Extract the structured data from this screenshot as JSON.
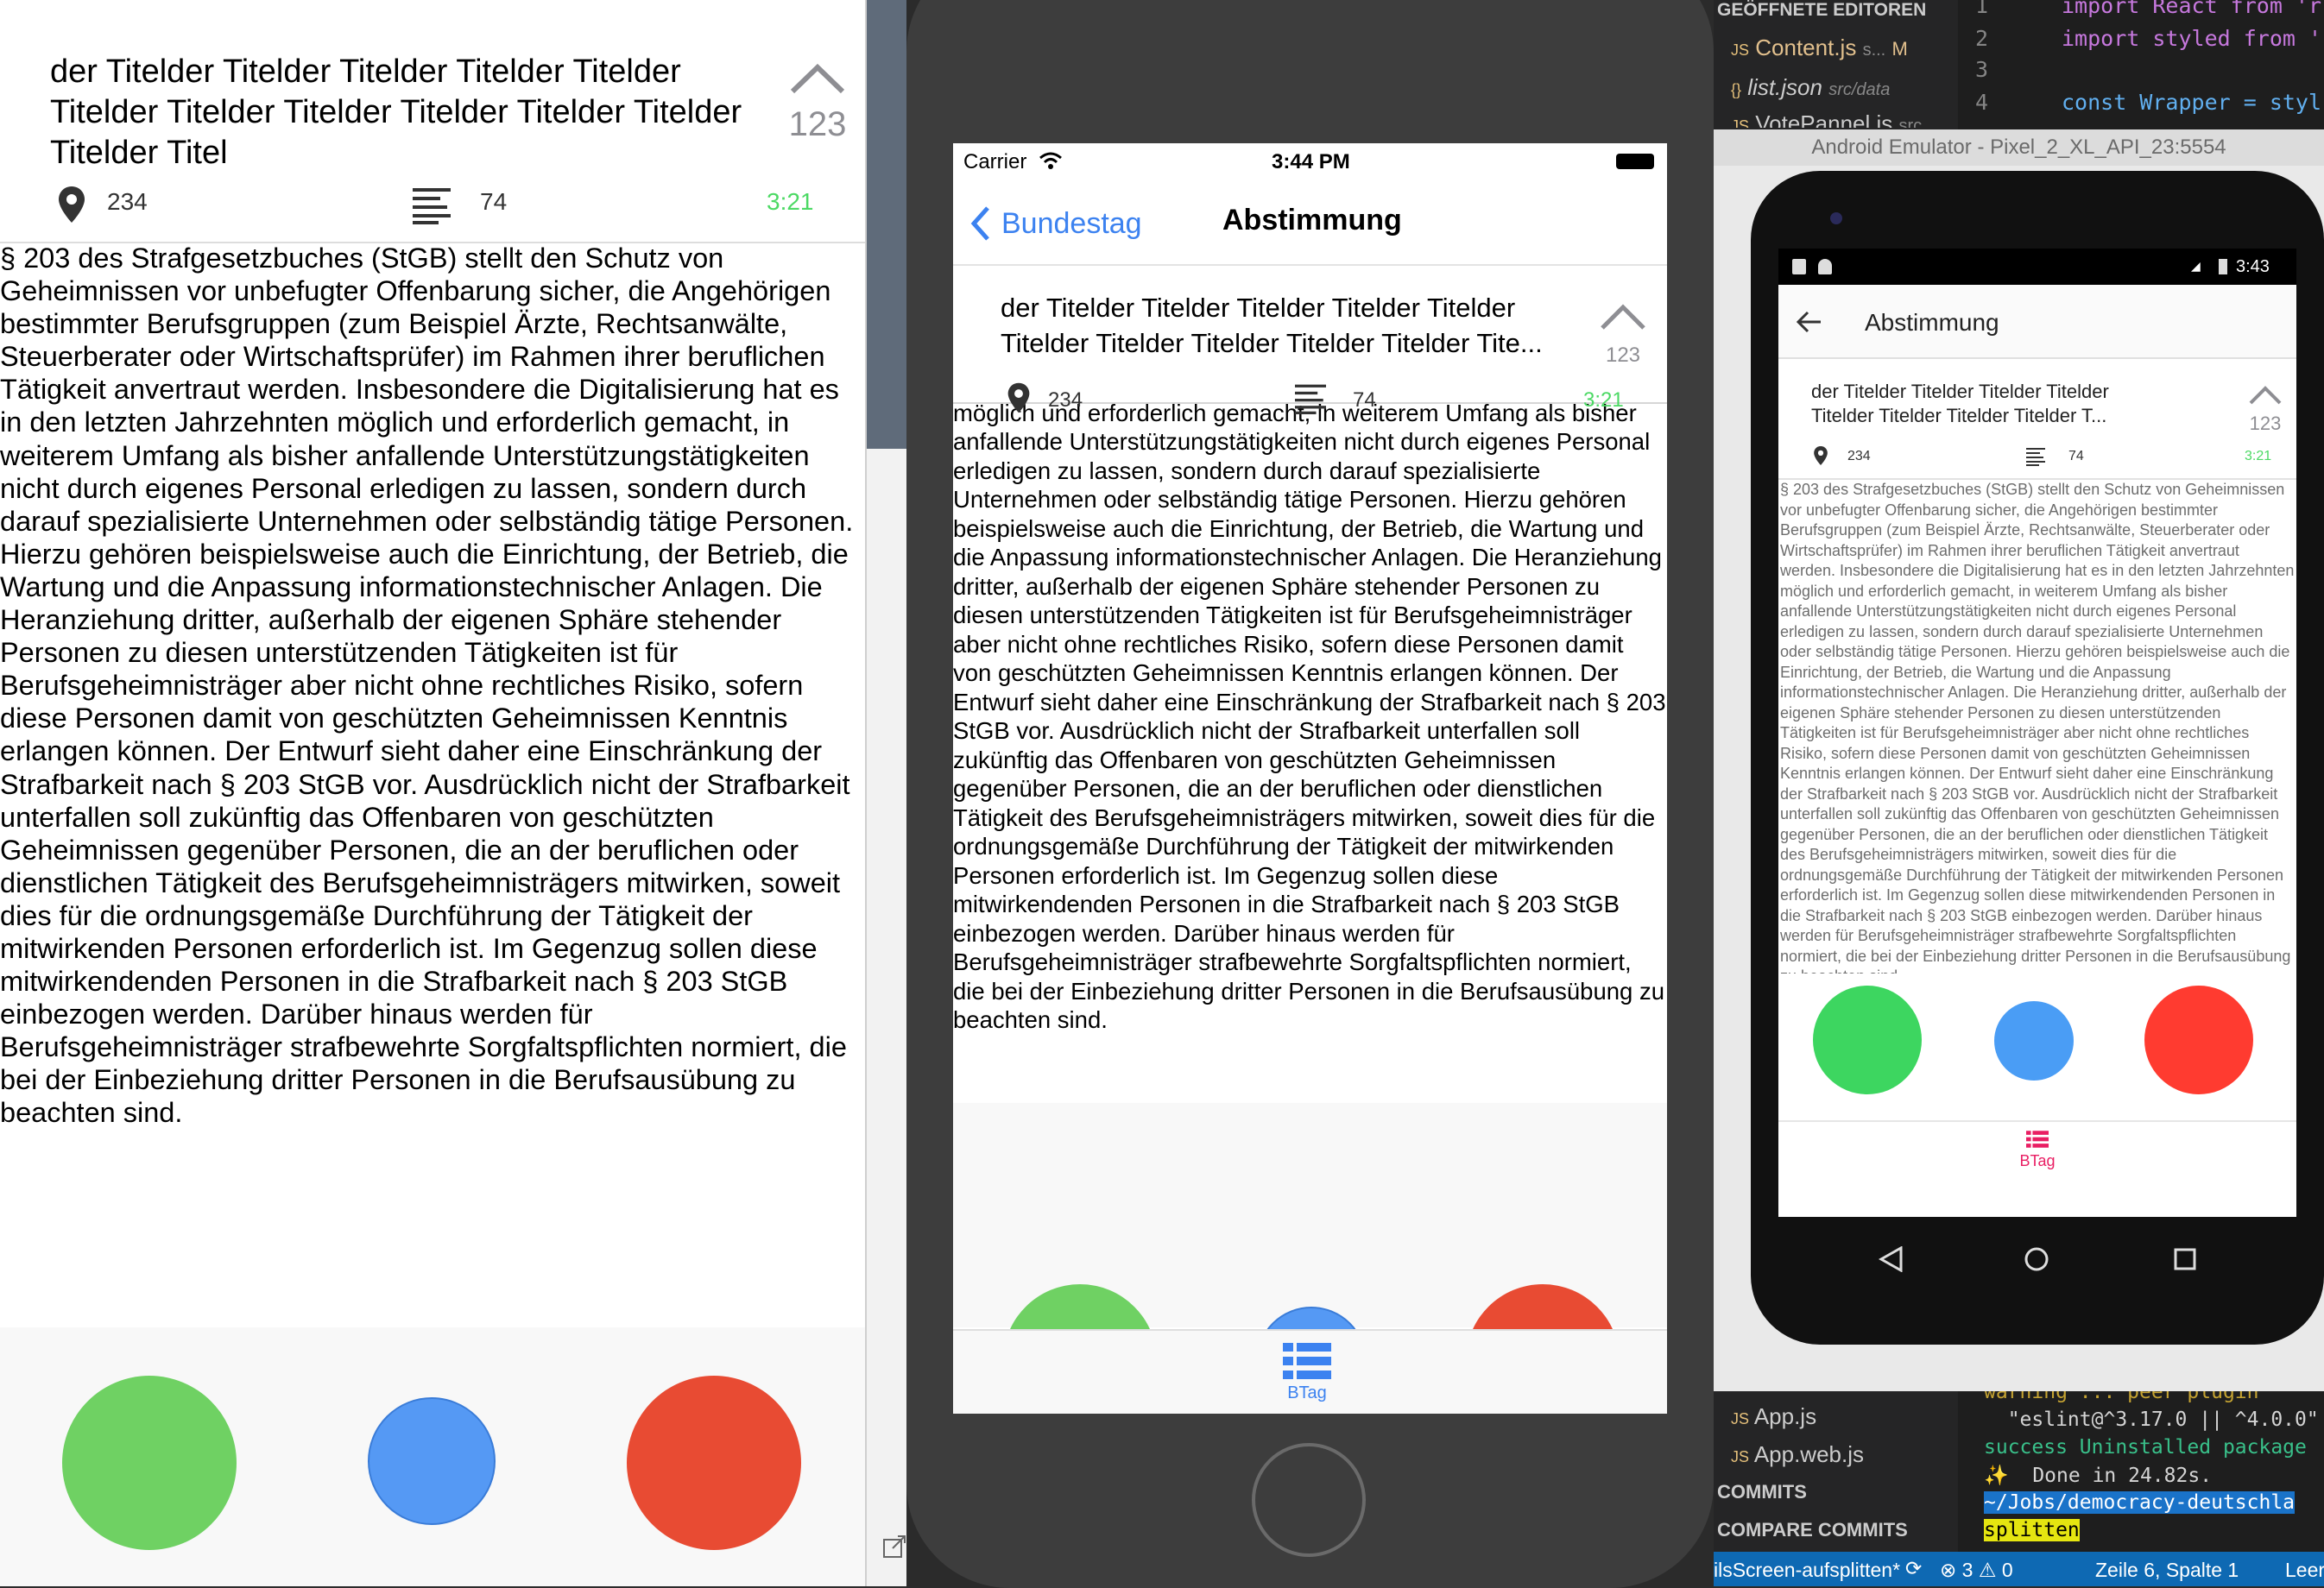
{
  "article": {
    "title": "der Titelder Titelder Titelder Titelder Titelder Titelder Titelder Titelder Titelder Titelder Titelder Titelder Titel",
    "title_short_ios_line1": "der Titelder Titelder Titelder Titelder Titelder",
    "title_short_ios_line2": "Titelder Titelder Titelder Titelder Titelder Tite...",
    "title_short_android_line1": "der Titelder Titelder Titelder Titelder",
    "title_short_android_line2": "Titelder Titelder Titelder Titelder T...",
    "vote_count": "123",
    "location_count": "234",
    "list_count": "74",
    "time": "3:21",
    "body": "§ 203 des Strafgesetzbuches (StGB) stellt den Schutz von Geheimnissen vor unbefugter Offenbarung sicher, die Angehörigen bestimmter Berufsgruppen (zum Beispiel Ärzte, Rechtsanwälte, Steuerberater oder Wirtschaftsprüfer) im Rahmen ihrer beruflichen Tätigkeit anvertraut werden. Insbesondere die Digitalisierung hat es in den letzten Jahrzehnten möglich und erforderlich gemacht, in weiterem Umfang als bisher anfallende Unterstützungstätigkeiten nicht durch eigenes Personal erledigen zu lassen, sondern durch darauf spezialisierte Unternehmen oder selbständig tätige Personen. Hierzu gehören beispielsweise auch die Einrichtung, der Betrieb, die Wartung und die Anpassung informationstechnischer Anlagen. Die Heranziehung dritter, außerhalb der eigenen Sphäre stehender Personen zu diesen unterstützenden Tätigkeiten ist für Berufsgeheimnisträger aber nicht ohne rechtliches Risiko, sofern diese Personen damit von geschützten Geheimnissen Kenntnis erlangen können. Der Entwurf sieht daher eine Einschränkung der Strafbarkeit nach § 203 StGB vor. Ausdrücklich nicht der Strafbarkeit unterfallen soll zukünftig das Offenbaren von geschützten Geheimnissen gegenüber Personen, die an der beruflichen oder dienstlichen Tätigkeit des Berufsgeheimnisträgers mitwirken, soweit dies für die ordnungsgemäße Durchführung der Tätigkeit der mitwirkenden Personen erforderlich ist. Im Gegenzug sollen diese mitwirkendenden Personen in die Strafbarkeit nach § 203 StGB einbezogen werden. Darüber hinaus werden für Berufsgeheimnisträger strafbewehrte Sorgfaltspflichten normiert, die bei der Einbeziehung dritter Personen in die Berufsausübung zu beachten sind.",
    "body_ios": "insbesondere die Digitalisierung hat es in den letzten Jahrzehnten möglich und erforderlich gemacht, in weiterem Umfang als bisher anfallende Unterstützungstätigkeiten nicht durch eigenes Personal erledigen zu lassen, sondern durch darauf spezialisierte Unternehmen oder selbständig tätige Personen. Hierzu gehören beispielsweise auch die Einrichtung, der Betrieb, die Wartung und die Anpassung informationstechnischer Anlagen. Die Heranziehung dritter, außerhalb der eigenen Sphäre stehender Personen zu diesen unterstützenden Tätigkeiten ist für Berufsgeheimnisträger aber nicht ohne rechtliches Risiko, sofern diese Personen damit von geschützten Geheimnissen Kenntnis erlangen können. Der Entwurf sieht daher eine Einschränkung der Strafbarkeit nach § 203 StGB vor. Ausdrücklich nicht der Strafbarkeit unterfallen soll zukünftig das Offenbaren von geschützten Geheimnissen gegenüber Personen, die an der beruflichen oder dienstlichen Tätigkeit des Berufsgeheimnisträgers mitwirken, soweit dies für die ordnungsgemäße Durchführung der Tätigkeit der mitwirkenden Personen erforderlich ist. Im Gegenzug sollen diese mitwirkendenden Personen in die Strafbarkeit nach § 203 StGB einbezogen werden. Darüber hinaus werden für Berufsgeheimnisträger strafbewehrte Sorgfaltspflichten normiert, die bei der Einbeziehung dritter Personen in die Berufsausübung zu beachten sind."
  },
  "ios": {
    "carrier": "Carrier",
    "time": "3:44 PM",
    "back_label": "Bundestag",
    "nav_title": "Abstimmung",
    "tab_label": "BTag"
  },
  "android": {
    "window_title": "Android Emulator - Pixel_2_XL_API_23:5554",
    "time": "3:43",
    "toolbar_title": "Abstimmung",
    "tab_label": "BTag"
  },
  "editor": {
    "open_editors_header": "GEÖFFNETE EDITOREN",
    "files": [
      {
        "icon": "JS",
        "name": "Content.js",
        "path": "s...",
        "badge": "M"
      },
      {
        "icon": "{}",
        "name": "list.json",
        "path": "src/data",
        "badge": ""
      },
      {
        "icon": "JS",
        "name": "VotePannel.js",
        "path": "src",
        "badge": ""
      }
    ],
    "bottom_files": [
      "App.js",
      "App.web.js"
    ],
    "sections": [
      "COMMITS",
      "COMPARE COMMITS"
    ],
    "code_lines": [
      {
        "num": "1",
        "text": "import React from 'r"
      },
      {
        "num": "2",
        "text": "import styled from '"
      },
      {
        "num": "3",
        "text": ""
      },
      {
        "num": "4",
        "text": "const Wrapper = styl"
      }
    ],
    "terminal_lines": [
      "warning ... peer plugin",
      "  \"eslint@^3.17.0 || ^4.0.0\"",
      "success Uninstalled package",
      "✨  Done in 24.82s.",
      "~/Jobs/democracy-deutschla",
      "splitten"
    ],
    "statusbar": {
      "branch": "ilsScreen-aufsplitten*",
      "errors": "3",
      "warnings": "0",
      "position": "Zeile 6, Spalte 1",
      "extra": "Leer"
    }
  },
  "colors": {
    "vote_yes": "#6fd163",
    "vote_abstain": "#5599f4",
    "vote_no": "#e84b33",
    "ios_blue": "#3c82f0",
    "time_green": "#4cd964",
    "android_tab_pink": "#e91e63"
  }
}
